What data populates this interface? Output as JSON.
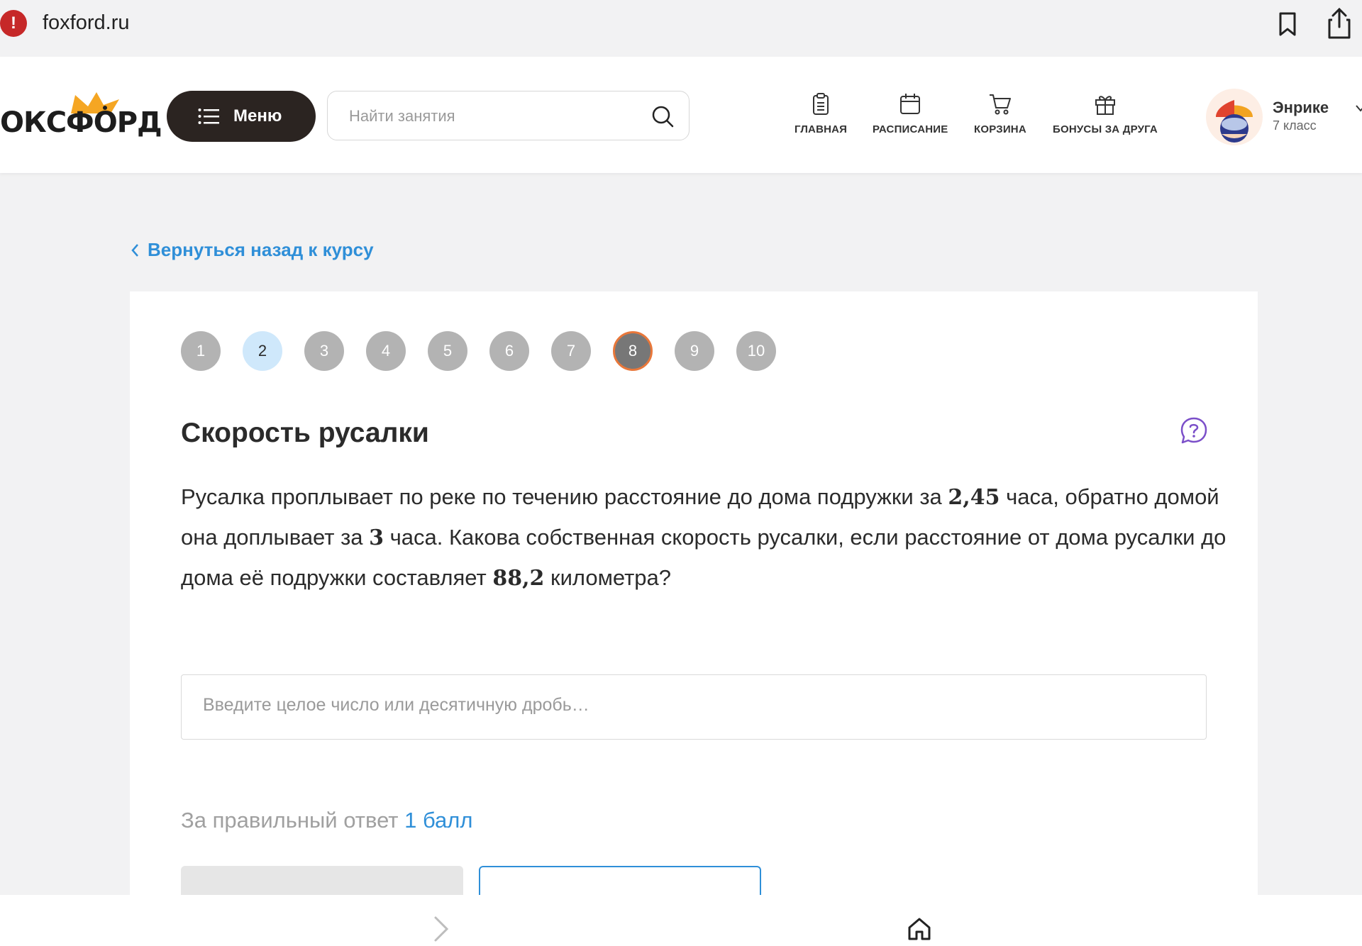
{
  "browser": {
    "url": "foxford.ru",
    "site_icon": "!"
  },
  "header": {
    "logo_text": "ОКСФОРД",
    "menu_label": "Меню",
    "search_placeholder": "Найти занятия",
    "nav": [
      {
        "label": "ГЛАВНАЯ",
        "icon": "clipboard-icon"
      },
      {
        "label": "РАСПИСАНИЕ",
        "icon": "calendar-icon"
      },
      {
        "label": "КОРЗИНА",
        "icon": "cart-icon"
      },
      {
        "label": "БОНУСЫ ЗА ДРУГА",
        "icon": "gift-icon"
      }
    ],
    "user": {
      "name": "Энрике",
      "grade": "7 класс"
    }
  },
  "back_link": "Вернуться назад к курсу",
  "steps": [
    "1",
    "2",
    "3",
    "4",
    "5",
    "6",
    "7",
    "8",
    "9",
    "10"
  ],
  "task": {
    "title": "Скорость русалки",
    "text_1": "Русалка проплывает по реке по течению расстояние до дома подружки за ",
    "num_1": "2,45",
    "text_2": " часа, обратно домой она доплывает за ",
    "num_2": "3",
    "text_3": " часа. Какова собственная скорость русалки, если расстояние от дома русалки до дома её подружки составляет ",
    "num_3": "88,2",
    "text_4": " километра?"
  },
  "answer_placeholder": "Введите целое число или десятичную дробь…",
  "score_label": "За правильный ответ",
  "score_value": "1 балл",
  "colors": {
    "accent": "#2f8fd8",
    "active_step_border": "#e8773a",
    "menu_button": "#2b2421"
  }
}
